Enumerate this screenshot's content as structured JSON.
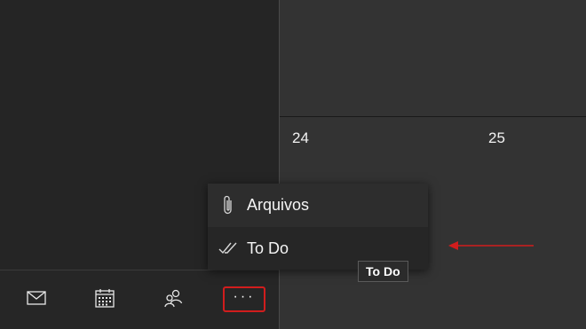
{
  "calendar": {
    "days": [
      "24",
      "25"
    ]
  },
  "menu": {
    "items": [
      {
        "label": "Arquivos",
        "icon": "paperclip-icon"
      },
      {
        "label": "To Do",
        "icon": "double-check-icon"
      }
    ]
  },
  "tooltip": {
    "text": "To Do"
  },
  "nav": {
    "buttons": [
      {
        "icon": "mail-icon"
      },
      {
        "icon": "calendar-icon"
      },
      {
        "icon": "people-icon"
      },
      {
        "icon": "more-icon",
        "label": "···"
      }
    ]
  },
  "colors": {
    "annotation_red": "#d11d1d",
    "panel_dark": "#252525",
    "calendar_bg": "#333333"
  }
}
